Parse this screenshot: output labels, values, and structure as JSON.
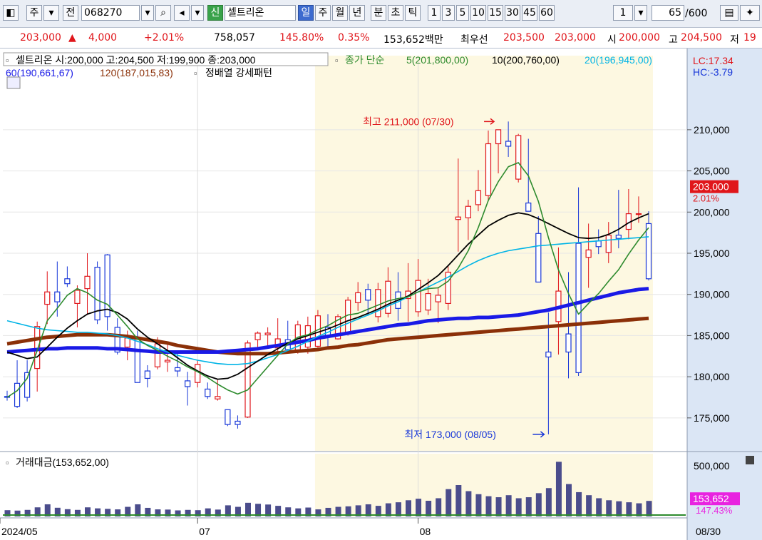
{
  "toolbar": {
    "code": "068270",
    "name": "셀트리온",
    "btn_stock": "주",
    "btn_all": "전",
    "btn_new": "신",
    "periods": [
      "일",
      "주",
      "월",
      "년",
      "분",
      "초",
      "틱"
    ],
    "active_period": "일",
    "intervals": [
      "1",
      "3",
      "5",
      "10",
      "15",
      "30",
      "45",
      "60"
    ],
    "multiplier": "1",
    "count": "65",
    "count_total": "/600"
  },
  "quote": {
    "price": "203,000",
    "change_arrow": "▲",
    "change": "4,000",
    "change_pct": "+2.01%",
    "volume": "758,057",
    "vol_ratio": "145.80%",
    "turnover": "0.35%",
    "amount": "153,652백만",
    "best_offer_label": "최우선",
    "best_ask": "203,500",
    "best_bid": "203,000",
    "open_label": "시",
    "open": "200,000",
    "high_label": "고",
    "high": "204,500",
    "low_label": "저",
    "low": "19"
  },
  "price_panel": {
    "header": "셀트리온 시:200,000 고:204,500 저:199,900 종:203,000",
    "ma_title": "종가 단순",
    "ma_labels": [
      {
        "text": "5(201,800,00)",
        "color": "#2e8b2e"
      },
      {
        "text": "10(200,760,00)",
        "color": "#000000"
      },
      {
        "text": "20(196,945,00)",
        "color": "#00b4e6"
      },
      {
        "text": "60(190,661,67)",
        "color": "#1a1ae6"
      },
      {
        "text": "120(187,015,83)",
        "color": "#8b3008"
      }
    ],
    "trend_label": "정배열 강세패턴",
    "lc": "LC:17.34",
    "hc": "HC:-3.79",
    "high_annot": "최고 211,000 (07/30)",
    "low_annot": "최저 173,000 (08/05)",
    "price_tag": "203,000",
    "pct_tag": "2.01%"
  },
  "volume_panel": {
    "title": "거래대금(153,652,00)",
    "tag_value": "153,652",
    "tag_pct": "147.43%"
  },
  "x_axis": {
    "labels": [
      "2024/05",
      "07",
      "08"
    ],
    "right_label": "08/30"
  },
  "colors": {
    "up": "#e0161b",
    "down": "#1736d8",
    "ma5": "#2e8b2e",
    "ma10": "#000000",
    "ma20": "#00b4e6",
    "ma60": "#1a1ae6",
    "ma120": "#8b3008",
    "highlight": "#fdf8e1",
    "volume": "#4b4d8c"
  },
  "chart_data": {
    "type": "candlestick",
    "y_ticks": [
      175000,
      180000,
      185000,
      190000,
      195000,
      200000,
      205000,
      210000
    ],
    "ylim": [
      171000,
      219000
    ],
    "volume_ticks": [
      500000
    ],
    "volume_ylim": [
      0,
      620000
    ],
    "candles": [
      {
        "o": 177600,
        "h": 178300,
        "l": 177100,
        "c": 177500
      },
      {
        "o": 179200,
        "h": 182000,
        "l": 176200,
        "c": 176400
      },
      {
        "o": 180500,
        "h": 182000,
        "l": 177000,
        "c": 177500
      },
      {
        "o": 181000,
        "h": 186700,
        "l": 178200,
        "c": 186100
      },
      {
        "o": 188800,
        "h": 192800,
        "l": 186400,
        "c": 190300
      },
      {
        "o": 190300,
        "h": 194000,
        "l": 187300,
        "c": 189100
      },
      {
        "o": 191900,
        "h": 193400,
        "l": 190900,
        "c": 191300
      },
      {
        "o": 188900,
        "h": 191100,
        "l": 186000,
        "c": 190500
      },
      {
        "o": 190700,
        "h": 195000,
        "l": 187500,
        "c": 192200
      },
      {
        "o": 193300,
        "h": 194000,
        "l": 186400,
        "c": 186900
      },
      {
        "o": 194800,
        "h": 194900,
        "l": 185600,
        "c": 187300
      },
      {
        "o": 186000,
        "h": 187100,
        "l": 182700,
        "c": 183000
      },
      {
        "o": 183600,
        "h": 185600,
        "l": 182000,
        "c": 184700
      },
      {
        "o": 184800,
        "h": 185600,
        "l": 179300,
        "c": 179300
      },
      {
        "o": 180700,
        "h": 181400,
        "l": 178700,
        "c": 179800
      },
      {
        "o": 181200,
        "h": 184800,
        "l": 180900,
        "c": 184000
      },
      {
        "o": 181800,
        "h": 184300,
        "l": 180600,
        "c": 182000
      },
      {
        "o": 181100,
        "h": 183200,
        "l": 180000,
        "c": 180700
      },
      {
        "o": 179500,
        "h": 180600,
        "l": 176500,
        "c": 178800
      },
      {
        "o": 179300,
        "h": 182000,
        "l": 178700,
        "c": 181500
      },
      {
        "o": 178500,
        "h": 179300,
        "l": 177300,
        "c": 177600
      },
      {
        "o": 177300,
        "h": 179600,
        "l": 177100,
        "c": 177600
      },
      {
        "o": 176000,
        "h": 176000,
        "l": 174000,
        "c": 174200
      },
      {
        "o": 174600,
        "h": 175300,
        "l": 173700,
        "c": 174200
      },
      {
        "o": 175100,
        "h": 184400,
        "l": 175000,
        "c": 184100
      },
      {
        "o": 184500,
        "h": 185500,
        "l": 183500,
        "c": 185300
      },
      {
        "o": 185100,
        "h": 186000,
        "l": 183400,
        "c": 185300
      },
      {
        "o": 183500,
        "h": 187100,
        "l": 182500,
        "c": 184600
      },
      {
        "o": 184500,
        "h": 186800,
        "l": 182800,
        "c": 183300
      },
      {
        "o": 183000,
        "h": 186800,
        "l": 182800,
        "c": 186300
      },
      {
        "o": 183600,
        "h": 187300,
        "l": 182800,
        "c": 186200
      },
      {
        "o": 183700,
        "h": 188100,
        "l": 183300,
        "c": 187400
      },
      {
        "o": 186000,
        "h": 187600,
        "l": 183400,
        "c": 184800
      },
      {
        "o": 184600,
        "h": 187600,
        "l": 184500,
        "c": 187300
      },
      {
        "o": 185300,
        "h": 189700,
        "l": 185000,
        "c": 189300
      },
      {
        "o": 189000,
        "h": 191500,
        "l": 188000,
        "c": 190200
      },
      {
        "o": 190600,
        "h": 191300,
        "l": 187400,
        "c": 189300
      },
      {
        "o": 187300,
        "h": 191400,
        "l": 186600,
        "c": 190600
      },
      {
        "o": 187700,
        "h": 193300,
        "l": 187200,
        "c": 191600
      },
      {
        "o": 190300,
        "h": 192700,
        "l": 186800,
        "c": 188300
      },
      {
        "o": 189500,
        "h": 193800,
        "l": 186700,
        "c": 190400
      },
      {
        "o": 187900,
        "h": 194300,
        "l": 187300,
        "c": 191700
      },
      {
        "o": 188100,
        "h": 191900,
        "l": 187500,
        "c": 190100
      },
      {
        "o": 189100,
        "h": 190900,
        "l": 186500,
        "c": 189900
      },
      {
        "o": 188900,
        "h": 193400,
        "l": 188100,
        "c": 192700
      },
      {
        "o": 199100,
        "h": 206500,
        "l": 195200,
        "c": 199400
      },
      {
        "o": 199300,
        "h": 201500,
        "l": 196600,
        "c": 200700
      },
      {
        "o": 200900,
        "h": 205100,
        "l": 200100,
        "c": 202600
      },
      {
        "o": 202000,
        "h": 209900,
        "l": 201300,
        "c": 208300
      },
      {
        "o": 208300,
        "h": 210000,
        "l": 204700,
        "c": 210000
      },
      {
        "o": 208600,
        "h": 211000,
        "l": 206700,
        "c": 208000
      },
      {
        "o": 204000,
        "h": 209500,
        "l": 203600,
        "c": 209300
      },
      {
        "o": 201100,
        "h": 208900,
        "l": 200300,
        "c": 200100
      },
      {
        "o": 197400,
        "h": 199500,
        "l": 192700,
        "c": 191500
      },
      {
        "o": 183000,
        "h": 187800,
        "l": 173000,
        "c": 182400
      },
      {
        "o": 186700,
        "h": 195700,
        "l": 182700,
        "c": 190400
      },
      {
        "o": 185200,
        "h": 192700,
        "l": 179800,
        "c": 183000
      },
      {
        "o": 196200,
        "h": 203000,
        "l": 180100,
        "c": 180500
      },
      {
        "o": 194500,
        "h": 198600,
        "l": 190800,
        "c": 195400
      },
      {
        "o": 196500,
        "h": 197900,
        "l": 194900,
        "c": 195800
      },
      {
        "o": 195100,
        "h": 198800,
        "l": 193800,
        "c": 197200
      },
      {
        "o": 197200,
        "h": 202700,
        "l": 195600,
        "c": 196800
      },
      {
        "o": 197900,
        "h": 202800,
        "l": 196700,
        "c": 199800
      },
      {
        "o": 199700,
        "h": 201900,
        "l": 198700,
        "c": 199800
      },
      {
        "o": 198600,
        "h": 200100,
        "l": 191700,
        "c": 191900
      }
    ],
    "series": [
      {
        "name": "5",
        "values": [
          177500,
          178300,
          179800,
          183200,
          186800,
          188300,
          189900,
          190700,
          190200,
          189300,
          188800,
          187500,
          186100,
          184600,
          183800,
          183200,
          182500,
          181900,
          181200,
          180600,
          179900,
          179100,
          178400,
          177900,
          178400,
          179800,
          181200,
          182600,
          184000,
          184800,
          185100,
          185700,
          186200,
          186900,
          187500,
          187700,
          188200,
          188700,
          189200,
          189500,
          189700,
          190300,
          190700,
          190800,
          191600,
          193200,
          195300,
          198100,
          201400,
          203700,
          205500,
          206000,
          204400,
          201300,
          196900,
          193000,
          190100,
          187600,
          188900,
          190100,
          191600,
          193000,
          194900,
          196600,
          198100
        ]
      },
      {
        "name": "10",
        "values": [
          183000,
          182600,
          182200,
          182400,
          183600,
          184800,
          185900,
          186800,
          187600,
          188000,
          188200,
          187800,
          187000,
          185800,
          184800,
          184000,
          183200,
          182300,
          181400,
          180700,
          180100,
          179700,
          179800,
          180300,
          181100,
          181900,
          182700,
          183400,
          184100,
          184600,
          185000,
          185400,
          185800,
          186300,
          186800,
          187200,
          187700,
          188200,
          188800,
          189300,
          189800,
          190600,
          191400,
          192300,
          193500,
          194800,
          196100,
          197200,
          198300,
          199000,
          199600,
          199900,
          199700,
          199200,
          198600,
          198000,
          197400,
          196900,
          196800,
          196900,
          197300,
          197900,
          198700,
          199300,
          199800
        ]
      },
      {
        "name": "20",
        "values": [
          186800,
          186500,
          186200,
          185900,
          185700,
          185600,
          185500,
          185400,
          185400,
          185300,
          185200,
          185000,
          184700,
          184300,
          183900,
          183400,
          183000,
          182600,
          182300,
          182000,
          181800,
          181600,
          181500,
          181500,
          181600,
          181900,
          182300,
          182700,
          183200,
          183700,
          184300,
          184900,
          185400,
          186000,
          186500,
          187000,
          187500,
          188000,
          188600,
          189100,
          189700,
          190300,
          190900,
          191500,
          192100,
          192800,
          193500,
          194100,
          194600,
          195000,
          195300,
          195500,
          195700,
          195900,
          196000,
          196100,
          196200,
          196300,
          196400,
          196500,
          196600,
          196700,
          196800,
          196900,
          197000
        ]
      },
      {
        "name": "60",
        "values": [
          183000,
          183100,
          183200,
          183300,
          183400,
          183400,
          183500,
          183500,
          183500,
          183500,
          183400,
          183400,
          183300,
          183200,
          183100,
          183000,
          183000,
          183000,
          183000,
          183000,
          183000,
          183000,
          183100,
          183200,
          183300,
          183400,
          183600,
          183800,
          184000,
          184200,
          184400,
          184700,
          184900,
          185100,
          185300,
          185500,
          185700,
          185900,
          186100,
          186300,
          186400,
          186600,
          186800,
          186900,
          187000,
          187100,
          187100,
          187200,
          187200,
          187300,
          187400,
          187500,
          187700,
          187900,
          188100,
          188400,
          188700,
          189000,
          189300,
          189600,
          189900,
          190200,
          190400,
          190600,
          190700
        ]
      },
      {
        "name": "120",
        "values": [
          184000,
          184200,
          184400,
          184600,
          184800,
          184900,
          185000,
          185100,
          185100,
          185100,
          185100,
          185000,
          184900,
          184700,
          184500,
          184300,
          184100,
          183800,
          183600,
          183400,
          183200,
          183000,
          182900,
          182800,
          182800,
          182800,
          182800,
          182900,
          183000,
          183100,
          183200,
          183300,
          183500,
          183600,
          183800,
          183900,
          184100,
          184300,
          184500,
          184600,
          184700,
          184800,
          184900,
          185000,
          185100,
          185200,
          185300,
          185400,
          185500,
          185600,
          185700,
          185800,
          185900,
          186000,
          186100,
          186200,
          186300,
          186400,
          186500,
          186600,
          186700,
          186800,
          186900,
          187000,
          187100
        ]
      }
    ],
    "volume": [
      62000,
      58000,
      65000,
      90000,
      120000,
      86000,
      72000,
      65000,
      90000,
      80000,
      75000,
      70000,
      95000,
      120000,
      85000,
      70000,
      68000,
      60000,
      65000,
      62000,
      80000,
      68000,
      110000,
      95000,
      135000,
      125000,
      118000,
      105000,
      90000,
      80000,
      88000,
      70000,
      85000,
      95000,
      100000,
      110000,
      120000,
      105000,
      130000,
      140000,
      160000,
      175000,
      155000,
      180000,
      270000,
      310000,
      250000,
      220000,
      200000,
      190000,
      210000,
      180000,
      190000,
      230000,
      280000,
      540000,
      320000,
      240000,
      210000,
      180000,
      160000,
      150000,
      140000,
      130000,
      153652
    ]
  }
}
